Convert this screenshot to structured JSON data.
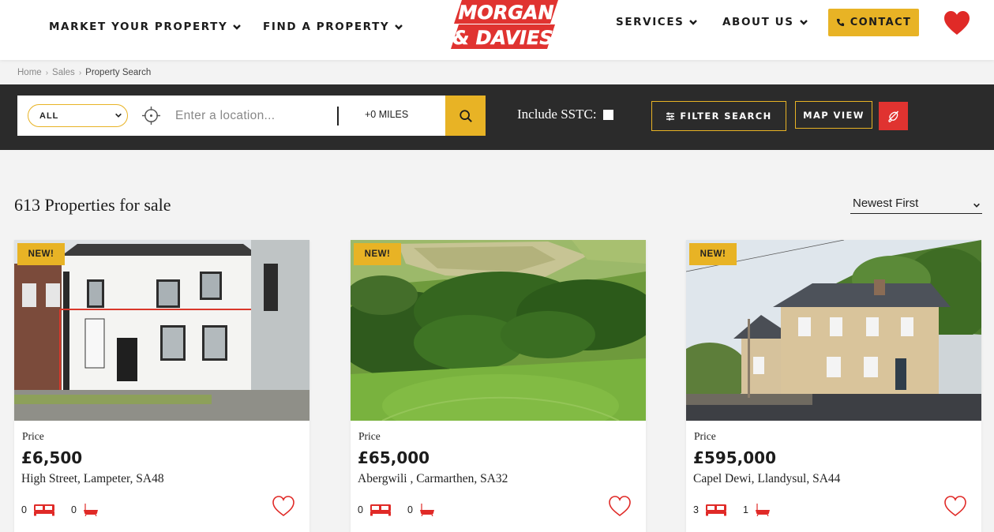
{
  "header": {
    "nav_left": [
      {
        "label": "MARKET YOUR PROPERTY"
      },
      {
        "label": "FIND A PROPERTY"
      }
    ],
    "nav_right": [
      {
        "label": "SERVICES"
      },
      {
        "label": "ABOUT US"
      }
    ],
    "logo": {
      "line1": "MORGAN",
      "line2": "& DAVIES"
    },
    "contact_label": "CONTACT",
    "heart_icon": "heart-icon"
  },
  "breadcrumb": [
    "Home",
    "Sales",
    "Property Search"
  ],
  "search": {
    "type_value": "ALL",
    "location_placeholder": "Enter a location...",
    "radius_value": "+0 MILES",
    "sstc_label": "Include SSTC:",
    "filter_label": "FILTER SEARCH",
    "map_label": "MAP VIEW"
  },
  "results": {
    "title": "613 Properties for sale",
    "sort_value": "Newest First"
  },
  "colors": {
    "accent": "#e8b325",
    "brand_red": "#e03330",
    "dark_bar": "#2b2b2b"
  },
  "listings": [
    {
      "badge": "NEW!",
      "price_label": "Price",
      "price": "£6,500",
      "address": "High Street, Lampeter, SA48",
      "beds": "0",
      "baths": "0"
    },
    {
      "badge": "NEW!",
      "price_label": "Price",
      "price": "£65,000",
      "address": "Abergwili , Carmarthen, SA32",
      "beds": "0",
      "baths": "0"
    },
    {
      "badge": "NEW!",
      "price_label": "Price",
      "price": "£595,000",
      "address": "Capel Dewi, Llandysul, SA44",
      "beds": "3",
      "baths": "1"
    }
  ]
}
